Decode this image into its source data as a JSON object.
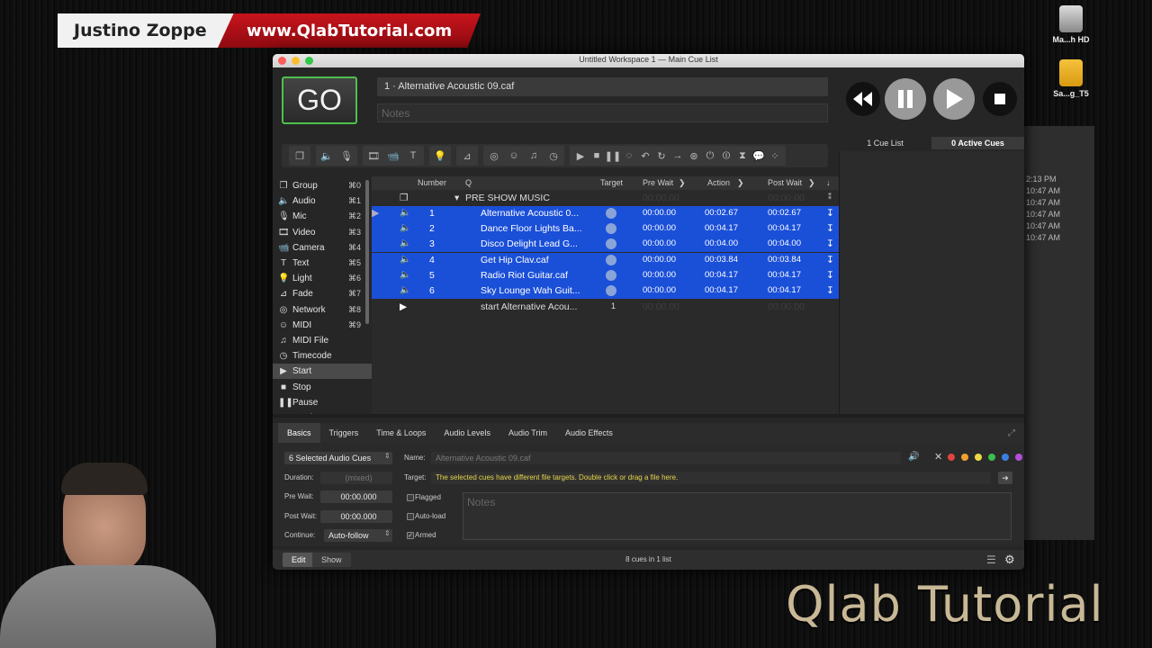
{
  "banner": {
    "name": "Justino Zoppe",
    "url": "www.QlabTutorial.com"
  },
  "watermark": "Qlab Tutorial",
  "desktop": {
    "hd_label": "Ma...h HD",
    "folder_label": "Sa...g_T5",
    "bg_window_times": [
      "2:13 PM",
      "10:47 AM",
      "10:47 AM",
      "10:47 AM",
      "10:47 AM",
      "10:47 AM"
    ]
  },
  "window": {
    "title": "Untitled Workspace 1 — Main Cue List",
    "go_label": "GO",
    "current_cue": "1 · Alternative Acoustic 09.caf",
    "notes_placeholder": "Notes"
  },
  "side_tabs": {
    "cue_lists": "1 Cue List",
    "active": "0 Active Cues"
  },
  "cue_types": [
    {
      "icon": "❐",
      "label": "Group",
      "shortcut": "⌘0"
    },
    {
      "icon": "🔈",
      "label": "Audio",
      "shortcut": "⌘1"
    },
    {
      "icon": "🎙",
      "label": "Mic",
      "shortcut": "⌘2"
    },
    {
      "icon": "🎞",
      "label": "Video",
      "shortcut": "⌘3"
    },
    {
      "icon": "📹",
      "label": "Camera",
      "shortcut": "⌘4"
    },
    {
      "icon": "T",
      "label": "Text",
      "shortcut": "⌘5"
    },
    {
      "icon": "💡",
      "label": "Light",
      "shortcut": "⌘6"
    },
    {
      "icon": "⊿",
      "label": "Fade",
      "shortcut": "⌘7"
    },
    {
      "icon": "◎",
      "label": "Network",
      "shortcut": "⌘8"
    },
    {
      "icon": "☺",
      "label": "MIDI",
      "shortcut": "⌘9"
    },
    {
      "icon": "♫",
      "label": "MIDI File",
      "shortcut": ""
    },
    {
      "icon": "◷",
      "label": "Timecode",
      "shortcut": ""
    },
    {
      "icon": "▶",
      "label": "Start",
      "shortcut": ""
    },
    {
      "icon": "■",
      "label": "Stop",
      "shortcut": ""
    },
    {
      "icon": "❚❚",
      "label": "Pause",
      "shortcut": ""
    },
    {
      "icon": "◷",
      "label": "Load",
      "shortcut": ""
    }
  ],
  "cue_headers": {
    "number": "Number",
    "q": "Q",
    "target": "Target",
    "prewait": "Pre Wait",
    "action": "Action",
    "postwait": "Post Wait"
  },
  "group_row": {
    "name": "PRE SHOW MUSIC",
    "dim1": "00:00.00",
    "dim2": "00:00.00"
  },
  "cues": [
    {
      "number": "1",
      "name": "Alternative Acoustic 0...",
      "prewait": "00:00.00",
      "action": "00:02.67",
      "postwait": "00:02.67"
    },
    {
      "number": "2",
      "name": "Dance Floor Lights Ba...",
      "prewait": "00:00.00",
      "action": "00:04.17",
      "postwait": "00:04.17"
    },
    {
      "number": "3",
      "name": "Disco Delight Lead G...",
      "prewait": "00:00.00",
      "action": "00:04.00",
      "postwait": "00:04.00"
    },
    {
      "number": "4",
      "name": "Get Hip Clav.caf",
      "prewait": "00:00.00",
      "action": "00:03.84",
      "postwait": "00:03.84"
    },
    {
      "number": "5",
      "name": "Radio Riot Guitar.caf",
      "prewait": "00:00.00",
      "action": "00:04.17",
      "postwait": "00:04.17"
    },
    {
      "number": "6",
      "name": "Sky Lounge Wah Guit...",
      "prewait": "00:00.00",
      "action": "00:04.17",
      "postwait": "00:04.17"
    }
  ],
  "start_row": {
    "name": "start Alternative Acou...",
    "target": "1",
    "dim1": "00:00.00",
    "dim2": "00:00.00"
  },
  "inspector": {
    "tabs": [
      "Basics",
      "Triggers",
      "Time & Loops",
      "Audio Levels",
      "Audio Trim",
      "Audio Effects"
    ],
    "selection": "6 Selected Audio Cues",
    "duration_label": "Duration:",
    "duration_value": "(mixed)",
    "prewait_label": "Pre Wait:",
    "prewait_value": "00:00.000",
    "postwait_label": "Post Wait:",
    "postwait_value": "00:00.000",
    "continue_label": "Continue:",
    "continue_value": "Auto-follow",
    "name_label": "Name:",
    "name_value": "Alternative Acoustic 09.caf",
    "target_label": "Target:",
    "target_value": "The selected cues have different file targets. Double click or drag a file here.",
    "flagged": "Flagged",
    "autoload": "Auto-load",
    "armed": "Armed",
    "notes_placeholder": "Notes",
    "color_dots": [
      "#e0443e",
      "#f0a030",
      "#e9d94a",
      "#3bbd4c",
      "#3a7fe0",
      "#b24fd8"
    ]
  },
  "status": {
    "edit": "Edit",
    "show": "Show",
    "count": "8 cues in 1 list"
  }
}
